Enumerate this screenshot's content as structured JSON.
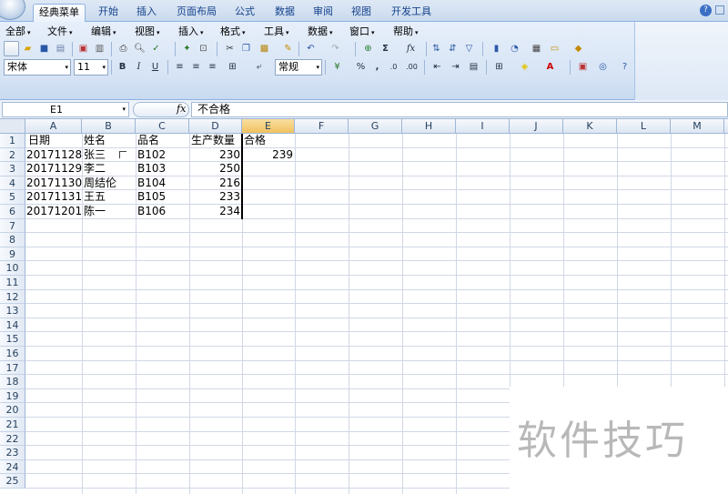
{
  "tabs": [
    "经典菜单",
    "开始",
    "插入",
    "页面布局",
    "公式",
    "数据",
    "审阅",
    "视图",
    "开发工具"
  ],
  "active_tab": "经典菜单",
  "menus": [
    "全部",
    "文件",
    "编辑",
    "视图",
    "插入",
    "格式",
    "工具",
    "数据",
    "窗口",
    "帮助"
  ],
  "font": {
    "name": "宋体",
    "size": "11"
  },
  "number_format": "常规",
  "formula_bar": {
    "name_box": "E1",
    "fx": "fx",
    "value": "不合格"
  },
  "columns": [
    "A",
    "B",
    "C",
    "D",
    "E",
    "F",
    "G",
    "H",
    "I",
    "J",
    "K",
    "L",
    "M",
    "N"
  ],
  "rows": [
    "1",
    "2",
    "3",
    "4",
    "5",
    "6",
    "7",
    "8",
    "9",
    "10",
    "11",
    "12",
    "13",
    "14",
    "15",
    "16",
    "17",
    "18",
    "19",
    "20",
    "21",
    "22",
    "23",
    "24",
    "25"
  ],
  "sheet": {
    "headers": {
      "a": "日期",
      "b": "姓名",
      "c": "品名",
      "d": "生产数量",
      "f": "合格"
    },
    "data": [
      {
        "date": "20171128",
        "name": "张三",
        "product": "B102",
        "qty": "230"
      },
      {
        "date": "20171129",
        "name": "李二",
        "product": "B103",
        "qty": "250"
      },
      {
        "date": "20171130",
        "name": "周结伦",
        "product": "B104",
        "qty": "216"
      },
      {
        "date": "20171131",
        "name": "王五",
        "product": "B105",
        "qty": "233"
      },
      {
        "date": "20171201",
        "name": "陈一",
        "product": "B106",
        "qty": "234"
      }
    ],
    "f2": "239"
  },
  "watermark": "软件技巧"
}
